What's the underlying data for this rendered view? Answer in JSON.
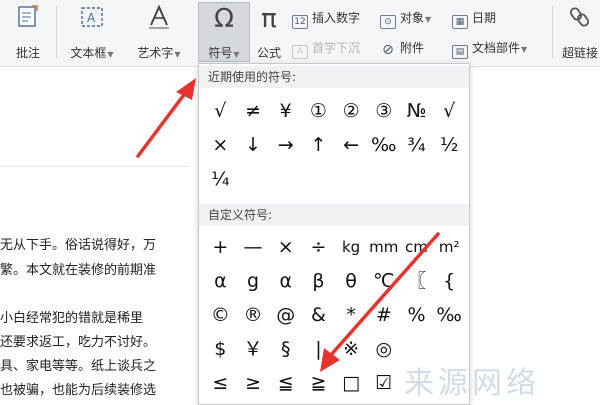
{
  "ribbon": {
    "annotate": "批注",
    "textbox": "文本框",
    "wordart": "艺术字",
    "symbol": "符号",
    "formula": "公式",
    "insert_number": "插入数字",
    "object": "对象",
    "date": "日期",
    "drop_cap": "首字下沉",
    "attachment": "附件",
    "doc_parts": "文档部件",
    "hyperlink": "超链接",
    "icons": {
      "annotate": "comment-icon",
      "textbox": "textbox-icon",
      "wordart": "wordart-icon",
      "symbol": "omega-icon",
      "formula": "pi-icon"
    },
    "symbol_glyph": "Ω",
    "formula_glyph": "π"
  },
  "dropdown": {
    "recent_title": "近期使用的符号:",
    "recent_symbols": [
      "√",
      "≠",
      "¥",
      "①",
      "②",
      "③",
      "№",
      "√",
      "×",
      "↓",
      "→",
      "↑",
      "←",
      "‰",
      "¾",
      "½",
      "¼"
    ],
    "custom_title": "自定义符号:",
    "custom_symbols": [
      "+",
      "—",
      "×",
      "÷",
      "kg",
      "mm",
      "cm",
      "m²",
      "α",
      "g",
      "α",
      "β",
      "θ",
      "℃",
      "〖",
      "{",
      "©",
      "®",
      "@",
      "&",
      "*",
      "#",
      "%",
      "‰",
      "$",
      "￥",
      "§",
      "|",
      "※",
      "◎",
      "",
      "",
      "≤",
      "≥",
      "≦",
      "≧",
      "□",
      "☑"
    ]
  },
  "document": {
    "lines": [
      "无从下手。俗话说得好，万",
      "繁。本文就在装修的前期准",
      "小白经常犯的错就是稀里",
      "还要求返工，吃力不讨好。",
      "具、家电等等。纸上谈兵之",
      "也被骗，也能为后续装修选"
    ]
  },
  "watermark": "来源网络",
  "colors": {
    "arrow": "#e8322c",
    "ribbon_bg": "#f5f6f7",
    "section_bg": "#f0f1f2"
  }
}
